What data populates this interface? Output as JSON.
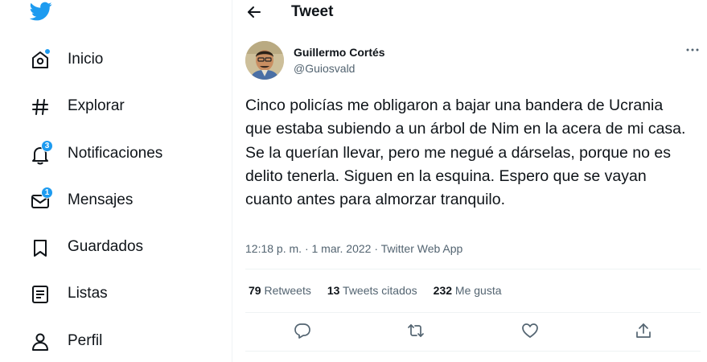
{
  "nav": {
    "items": [
      {
        "label": "Inicio",
        "icon": "home-icon"
      },
      {
        "label": "Explorar",
        "icon": "hashtag-icon"
      },
      {
        "label": "Notificaciones",
        "icon": "bell-icon",
        "badge": "3"
      },
      {
        "label": "Mensajes",
        "icon": "envelope-icon",
        "badge": "1"
      },
      {
        "label": "Guardados",
        "icon": "bookmark-icon"
      },
      {
        "label": "Listas",
        "icon": "list-icon"
      },
      {
        "label": "Perfil",
        "icon": "person-icon"
      }
    ]
  },
  "header": {
    "title": "Tweet"
  },
  "tweet": {
    "author_name": "Guillermo Cortés",
    "author_handle": "@Guiosvald",
    "text": "Cinco policías me obligaron a bajar una bandera de Ucrania que estaba subiendo a un árbol de Nim en la acera de mi casa. Se la querían llevar, pero me negué a dárselas, porque no es delito tenerla. Siguen en la esquina. Espero que se vayan cuanto antes para almorzar tranquilo.",
    "time": "12:18 p. m.",
    "sep": "·",
    "date": "1 mar. 2022",
    "app": "Twitter Web App"
  },
  "stats": {
    "retweets_num": "79",
    "retweets_label": "Retweets",
    "quotes_num": "13",
    "quotes_label": "Tweets citados",
    "likes_num": "232",
    "likes_label": "Me gusta"
  },
  "colors": {
    "accent": "#1d9bf0",
    "text": "#0f1419",
    "muted": "#536471",
    "border": "#eff3f4"
  }
}
